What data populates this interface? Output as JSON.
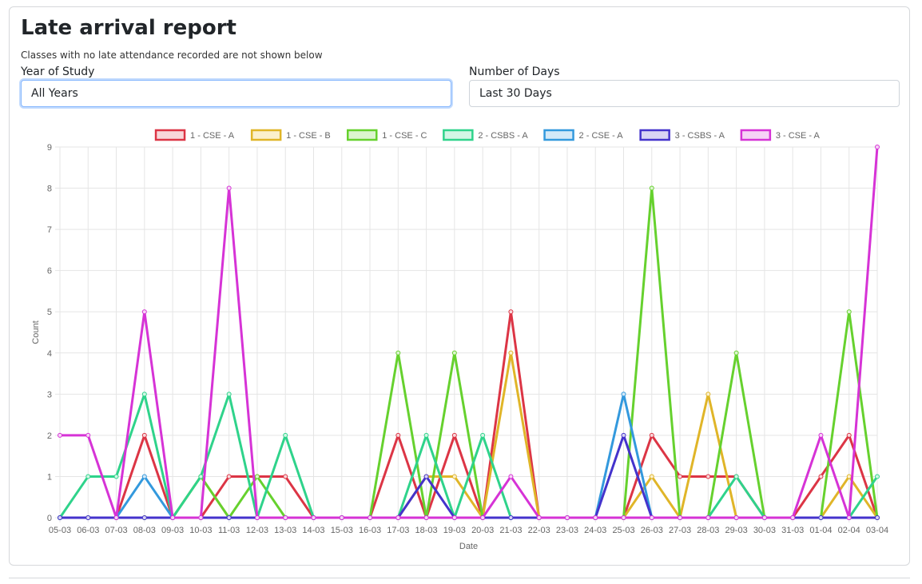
{
  "header": {
    "title": "Late arrival report",
    "subtitle": "Classes with no late attendance recorded are not shown below"
  },
  "filters": {
    "year_label": "Year of Study",
    "year_value": "All Years",
    "days_label": "Number of Days",
    "days_value": "Last 30 Days"
  },
  "chart_data": {
    "type": "line",
    "xlabel": "Date",
    "ylabel": "Count",
    "ylim": [
      0,
      9
    ],
    "grid": true,
    "legend_position": "top",
    "categories": [
      "05-03",
      "06-03",
      "07-03",
      "08-03",
      "09-03",
      "10-03",
      "11-03",
      "12-03",
      "13-03",
      "14-03",
      "15-03",
      "16-03",
      "17-03",
      "18-03",
      "19-03",
      "20-03",
      "21-03",
      "22-03",
      "23-03",
      "24-03",
      "25-03",
      "26-03",
      "27-03",
      "28-03",
      "29-03",
      "30-03",
      "31-03",
      "01-04",
      "02-04",
      "03-04"
    ],
    "series": [
      {
        "name": "1 - CSE - A",
        "color": "#dc3545",
        "fill": "#f8d7da",
        "values": [
          0,
          0,
          0,
          2,
          0,
          0,
          1,
          1,
          1,
          0,
          0,
          0,
          2,
          0,
          2,
          0,
          5,
          0,
          0,
          0,
          0,
          2,
          1,
          1,
          1,
          0,
          0,
          1,
          2,
          0
        ]
      },
      {
        "name": "1 - CSE - B",
        "color": "#e0b528",
        "fill": "#fbf0cc",
        "values": [
          0,
          0,
          0,
          0,
          0,
          1,
          0,
          0,
          0,
          0,
          0,
          0,
          0,
          1,
          1,
          0,
          4,
          0,
          0,
          0,
          0,
          1,
          0,
          3,
          0,
          0,
          0,
          0,
          1,
          0
        ]
      },
      {
        "name": "1 - CSE - C",
        "color": "#66d12e",
        "fill": "#dcf5cf",
        "values": [
          0,
          0,
          0,
          0,
          0,
          1,
          0,
          1,
          0,
          0,
          0,
          0,
          4,
          0,
          4,
          0,
          0,
          0,
          0,
          0,
          0,
          8,
          0,
          0,
          4,
          0,
          0,
          0,
          5,
          0
        ]
      },
      {
        "name": "2 - CSBS - A",
        "color": "#2fd38b",
        "fill": "#d2f6e5",
        "values": [
          0,
          1,
          1,
          3,
          0,
          1,
          3,
          0,
          2,
          0,
          0,
          0,
          0,
          2,
          0,
          2,
          0,
          0,
          0,
          0,
          0,
          0,
          0,
          0,
          1,
          0,
          0,
          0,
          0,
          1
        ]
      },
      {
        "name": "2 - CSE - A",
        "color": "#3399dd",
        "fill": "#d3e9f8",
        "values": [
          0,
          0,
          0,
          1,
          0,
          0,
          0,
          0,
          0,
          0,
          0,
          0,
          0,
          0,
          0,
          0,
          0,
          0,
          0,
          0,
          3,
          0,
          0,
          0,
          0,
          0,
          0,
          0,
          0,
          0
        ]
      },
      {
        "name": "3 - CSBS - A",
        "color": "#4433cc",
        "fill": "#d8d4f4",
        "values": [
          0,
          0,
          0,
          0,
          0,
          0,
          0,
          0,
          0,
          0,
          0,
          0,
          0,
          1,
          0,
          0,
          0,
          0,
          0,
          0,
          2,
          0,
          0,
          0,
          0,
          0,
          0,
          0,
          0,
          0
        ]
      },
      {
        "name": "3 - CSE - A",
        "color": "#d633d6",
        "fill": "#f6d3f6",
        "values": [
          2,
          2,
          0,
          5,
          0,
          0,
          8,
          0,
          0,
          0,
          0,
          0,
          0,
          0,
          0,
          0,
          1,
          0,
          0,
          0,
          0,
          0,
          0,
          0,
          0,
          0,
          0,
          2,
          0,
          9
        ]
      }
    ]
  }
}
